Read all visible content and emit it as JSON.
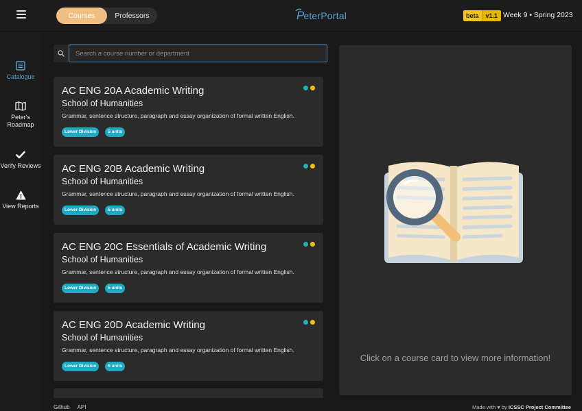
{
  "header": {
    "tabs": [
      {
        "label": "Courses",
        "active": true
      },
      {
        "label": "Professors",
        "active": false
      }
    ],
    "logo_initial": "P",
    "logo_text": "eterPortal",
    "beta_label": "beta",
    "version": "v1.1",
    "term": "Week 9 • Spring 2023"
  },
  "sidebar": {
    "items": [
      {
        "label": "Catalogue",
        "icon": "catalogue-icon",
        "active": true
      },
      {
        "label_line1": "Peter's",
        "label_line2": "Roadmap",
        "icon": "map-icon"
      },
      {
        "label": "Verify Reviews",
        "icon": "check-icon"
      },
      {
        "label": "View Reports",
        "icon": "warning-icon"
      }
    ]
  },
  "search": {
    "placeholder": "Search a course number or department",
    "value": ""
  },
  "courses": [
    {
      "title": "AC ENG 20A Academic Writing",
      "school": "School of Humanities",
      "description": "Grammar, sentence structure, paragraph and essay organization of formal written English.",
      "tags": [
        "Lower Division",
        "5 units"
      ]
    },
    {
      "title": "AC ENG 20B Academic Writing",
      "school": "School of Humanities",
      "description": "Grammar, sentence structure, paragraph and essay organization of formal written English.",
      "tags": [
        "Lower Division",
        "5 units"
      ]
    },
    {
      "title": "AC ENG 20C Essentials of Academic Writing",
      "school": "School of Humanities",
      "description": "Grammar, sentence structure, paragraph and essay organization of formal written English.",
      "tags": [
        "Lower Division",
        "5 units"
      ]
    },
    {
      "title": "AC ENG 20D Academic Writing",
      "school": "School of Humanities",
      "description": "Grammar, sentence structure, paragraph and essay organization of formal written English.",
      "tags": [
        "Lower Division",
        "5 units"
      ]
    }
  ],
  "panel": {
    "hint": "Click on a course card to view more information!"
  },
  "footer": {
    "links": [
      "Github",
      "API"
    ],
    "made_with": "Made with ♥ by",
    "org": "ICSSC Project Committee"
  },
  "colors": {
    "accent": "#56a3cc",
    "toggle_active": "#efbf84",
    "tag": "#1fa9c2",
    "dot_teal": "#1fb3b3",
    "dot_yellow": "#f2c10f",
    "badge": "#f4c514"
  }
}
